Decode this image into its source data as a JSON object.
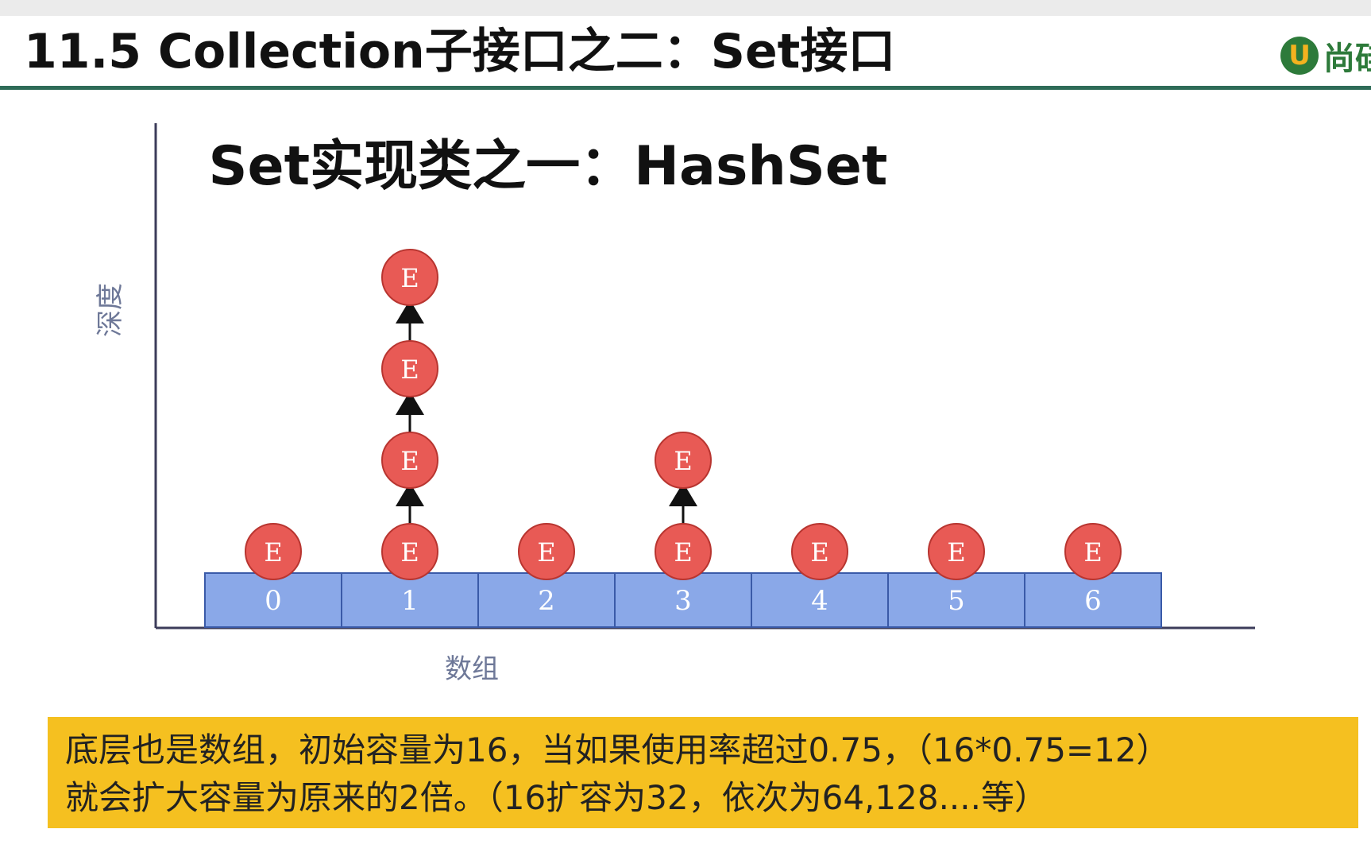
{
  "header": {
    "title": "11.5 Collection子接口之二：Set接口",
    "logo_mark": "U",
    "logo_text": "尚硅"
  },
  "diagram": {
    "title": "Set实现类之一：HashSet",
    "y_axis_label": "深度",
    "x_axis_label": "数组",
    "node_label": "E",
    "buckets": [
      {
        "index": "0",
        "chain_length": 1
      },
      {
        "index": "1",
        "chain_length": 4
      },
      {
        "index": "2",
        "chain_length": 1
      },
      {
        "index": "3",
        "chain_length": 2
      },
      {
        "index": "4",
        "chain_length": 1
      },
      {
        "index": "5",
        "chain_length": 1
      },
      {
        "index": "6",
        "chain_length": 1
      }
    ],
    "colors": {
      "node_fill": "#e85a55",
      "node_stroke": "#b83530",
      "bucket_fill": "#8aa8e8",
      "bucket_stroke": "#3a5aa8",
      "axis": "#3c3c5a",
      "label": "#6e7898"
    }
  },
  "caption": {
    "line1": "底层也是数组，初始容量为16，当如果使用率超过0.75，（16*0.75=12）",
    "line2": "就会扩大容量为原来的2倍。（16扩容为32，依次为64,128....等）",
    "background": "#f5c020"
  }
}
